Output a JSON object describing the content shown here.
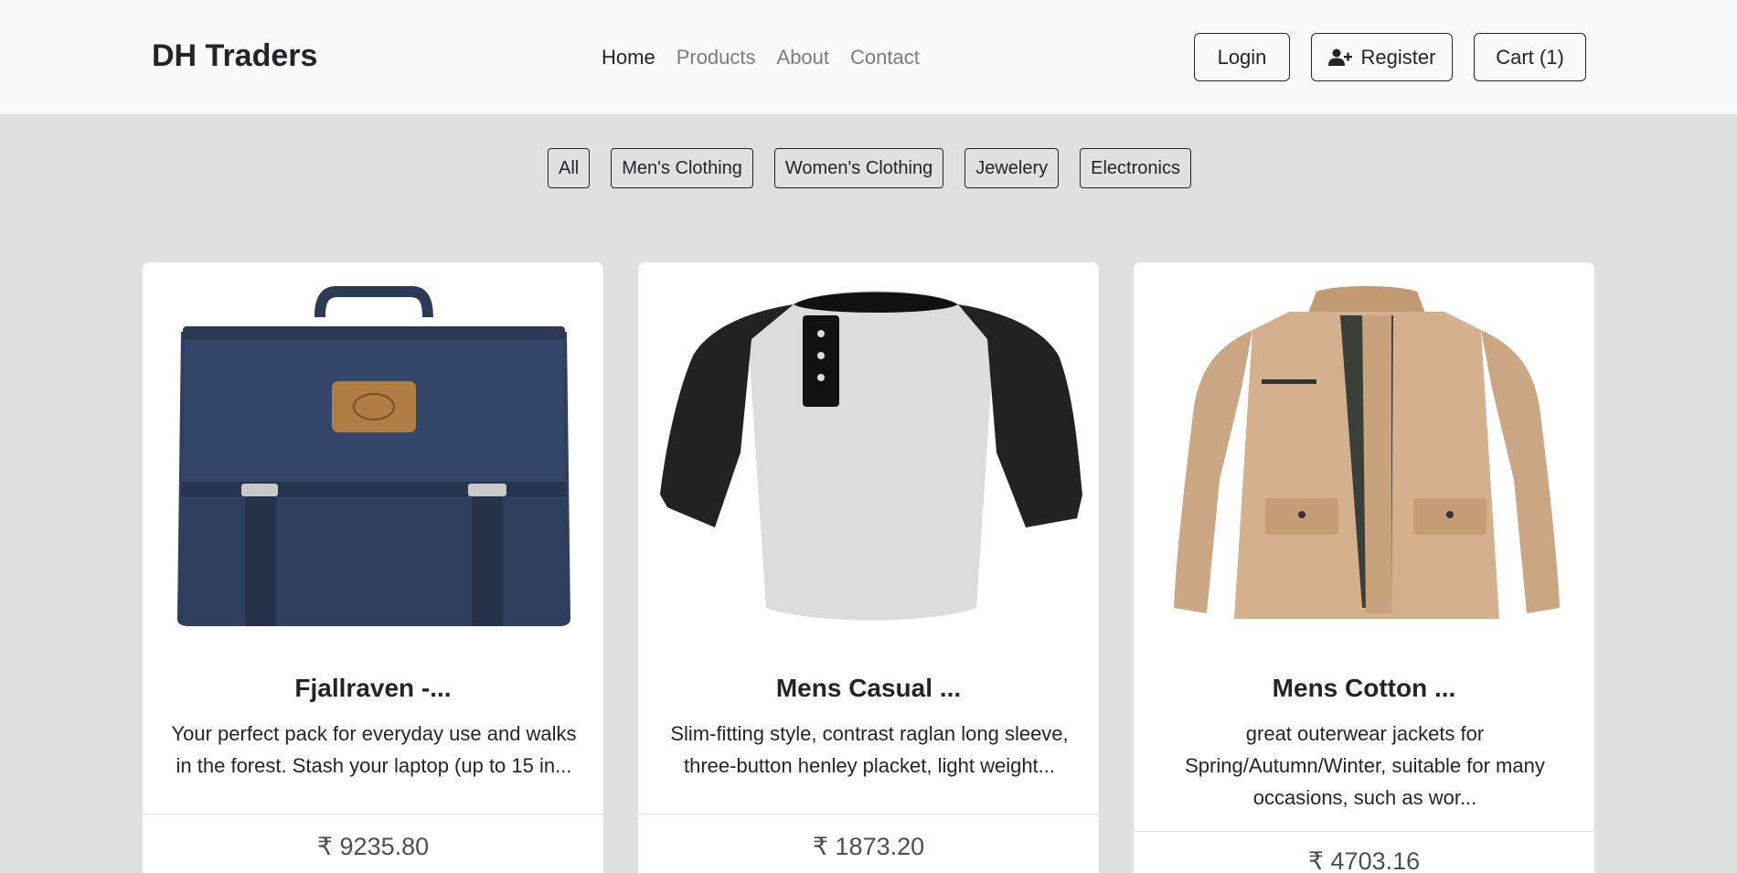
{
  "navbar": {
    "brand": "DH Traders",
    "links": [
      {
        "label": "Home",
        "active": true
      },
      {
        "label": "Products",
        "active": false
      },
      {
        "label": "About",
        "active": false
      },
      {
        "label": "Contact",
        "active": false
      }
    ],
    "login_label": "Login",
    "register_label": "Register",
    "register_icon": "user-plus-icon",
    "cart_label": "Cart (1)"
  },
  "filters": [
    {
      "label": "All"
    },
    {
      "label": "Men's Clothing"
    },
    {
      "label": "Women's Clothing"
    },
    {
      "label": "Jewelery"
    },
    {
      "label": "Electronics"
    }
  ],
  "products": [
    {
      "title": "Fjallraven -...",
      "description": "Your perfect pack for everyday use and walks in the forest. Stash your laptop (up to 15 in...",
      "price": "₹ 9235.80",
      "image": "backpack-image"
    },
    {
      "title": "Mens Casual ...",
      "description": "Slim-fitting style, contrast raglan long sleeve, three-button henley placket, light weight...",
      "price": "₹ 1873.20",
      "image": "raglan-tshirt-image"
    },
    {
      "title": "Mens Cotton ...",
      "description": "great outerwear jackets for Spring/Autumn/Winter, suitable for many occasions, such as wor...",
      "price": "₹ 4703.16",
      "image": "jacket-image"
    }
  ],
  "colors": {
    "navbar_bg": "#f8f9fa",
    "page_bg": "#e0e0e0",
    "text_dark": "#212529",
    "text_muted": "#7a7d80"
  }
}
